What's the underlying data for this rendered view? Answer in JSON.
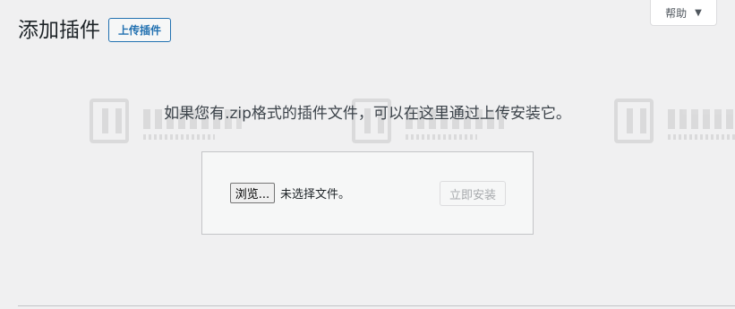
{
  "header": {
    "title": "添加插件",
    "upload_button": "上传插件",
    "help_tab": "帮助"
  },
  "upload": {
    "help_text": "如果您有.zip格式的插件文件，可以在这里通过上传安装它。",
    "browse_button": "浏览...",
    "no_file_text": "未选择文件。",
    "install_button": "立即安装",
    "install_disabled": true
  },
  "colors": {
    "accent": "#2271b1",
    "background": "#f0f0f1"
  }
}
